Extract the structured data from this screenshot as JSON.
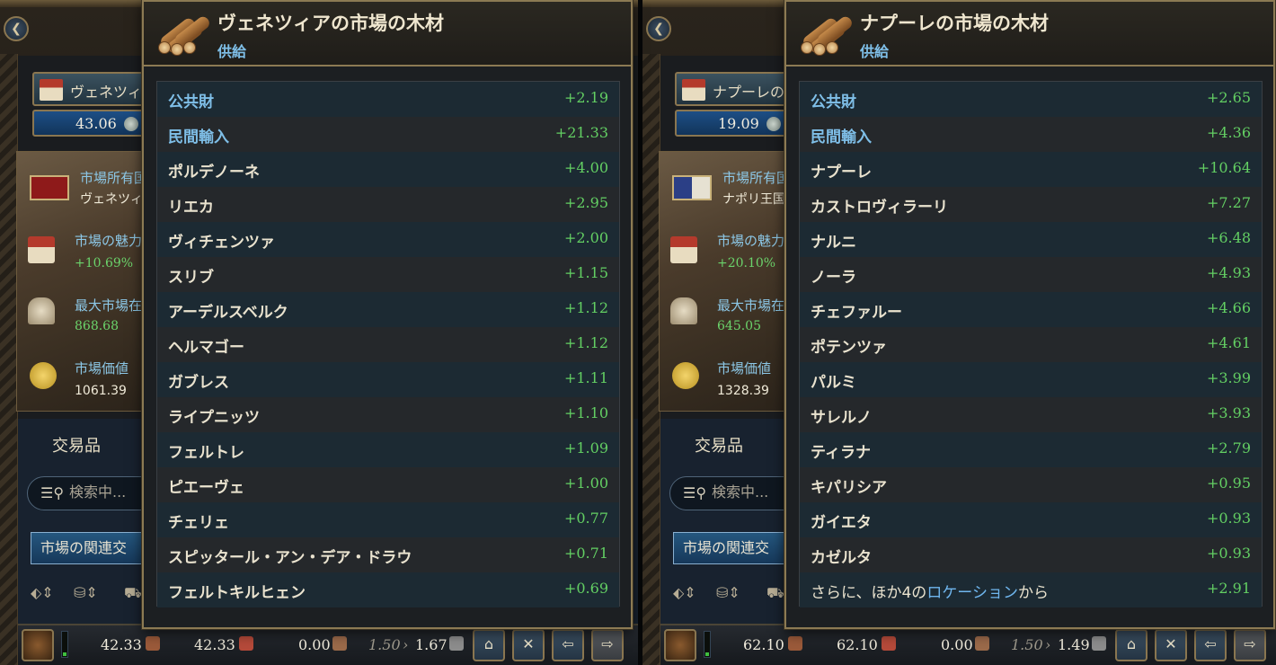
{
  "left": {
    "market_name": "ヴェネツィ",
    "market_value": "43.06",
    "owner_label": "市場所有国",
    "owner_value": "ヴェネツィ",
    "attraction_label": "市場の魅力",
    "attraction_value": "+10.69%",
    "max_label": "最大市場在",
    "max_value": "868.68",
    "price_label": "市場価値",
    "price_value": "1061.39",
    "goods_title": "交易品",
    "search_placeholder": "検索中...",
    "related_label": "市場の関連交",
    "bottom": {
      "supply": "42.33",
      "demand": "42.33",
      "balance": "0.00",
      "base_price": "1.50",
      "price": "1.67",
      "arrow": "›"
    },
    "tooltip": {
      "title": "ヴェネツィアの市場の木材",
      "subtitle": "供給",
      "rows": [
        {
          "name": "公共財",
          "value": "+2.19",
          "blue": true
        },
        {
          "name": "民間輸入",
          "value": "+21.33",
          "blue": true
        },
        {
          "name": "ポルデノーネ",
          "value": "+4.00"
        },
        {
          "name": "リエカ",
          "value": "+2.95"
        },
        {
          "name": "ヴィチェンツァ",
          "value": "+2.00"
        },
        {
          "name": "スリブ",
          "value": "+1.15"
        },
        {
          "name": "アーデルスベルク",
          "value": "+1.12"
        },
        {
          "name": "ヘルマゴー",
          "value": "+1.12"
        },
        {
          "name": "ガブレス",
          "value": "+1.11"
        },
        {
          "name": "ライプニッツ",
          "value": "+1.10"
        },
        {
          "name": "フェルトレ",
          "value": "+1.09"
        },
        {
          "name": "ピエーヴェ",
          "value": "+1.00"
        },
        {
          "name": "チェリェ",
          "value": "+0.77"
        },
        {
          "name": "スピッタール・アン・デア・ドラウ",
          "value": "+0.71"
        },
        {
          "name": "フェルトキルヒェン",
          "value": "+0.69"
        }
      ]
    }
  },
  "right": {
    "market_name": "ナプーレの",
    "market_value": "19.09",
    "owner_label": "市場所有国",
    "owner_value": "ナポリ王国",
    "attraction_label": "市場の魅力",
    "attraction_value": "+20.10%",
    "max_label": "最大市場在",
    "max_value": "645.05",
    "price_label": "市場価値",
    "price_value": "1328.39",
    "goods_title": "交易品",
    "search_placeholder": "検索中...",
    "related_label": "市場の関連交",
    "bottom": {
      "supply": "62.10",
      "demand": "62.10",
      "balance": "0.00",
      "base_price": "1.50",
      "price": "1.49",
      "arrow": "›"
    },
    "tooltip": {
      "title": "ナプーレの市場の木材",
      "subtitle": "供給",
      "rows": [
        {
          "name": "公共財",
          "value": "+2.65",
          "blue": true
        },
        {
          "name": "民間輸入",
          "value": "+4.36",
          "blue": true
        },
        {
          "name": "ナプーレ",
          "value": "+10.64"
        },
        {
          "name": "カストロヴィラーリ",
          "value": "+7.27"
        },
        {
          "name": "ナルニ",
          "value": "+6.48"
        },
        {
          "name": "ノーラ",
          "value": "+4.93"
        },
        {
          "name": "チェファルー",
          "value": "+4.66"
        },
        {
          "name": "ポテンツァ",
          "value": "+4.61"
        },
        {
          "name": "パルミ",
          "value": "+3.99"
        },
        {
          "name": "サレルノ",
          "value": "+3.93"
        },
        {
          "name": "ティラナ",
          "value": "+2.79"
        },
        {
          "name": "キパリシア",
          "value": "+0.95"
        },
        {
          "name": "ガイエタ",
          "value": "+0.93"
        },
        {
          "name": "カゼルタ",
          "value": "+0.93"
        }
      ],
      "more": {
        "prefix": "さらに、ほか4の",
        "link": "ロケーション",
        "suffix": "から",
        "value": "+2.91"
      }
    }
  },
  "icons": {
    "back": "back-arrow-icon",
    "search": "search-icon",
    "wood": "wood-logs-icon"
  },
  "colors": {
    "positive": "#63cf63",
    "link_blue": "#7fbfe8",
    "border_gold": "#8c7a53"
  }
}
